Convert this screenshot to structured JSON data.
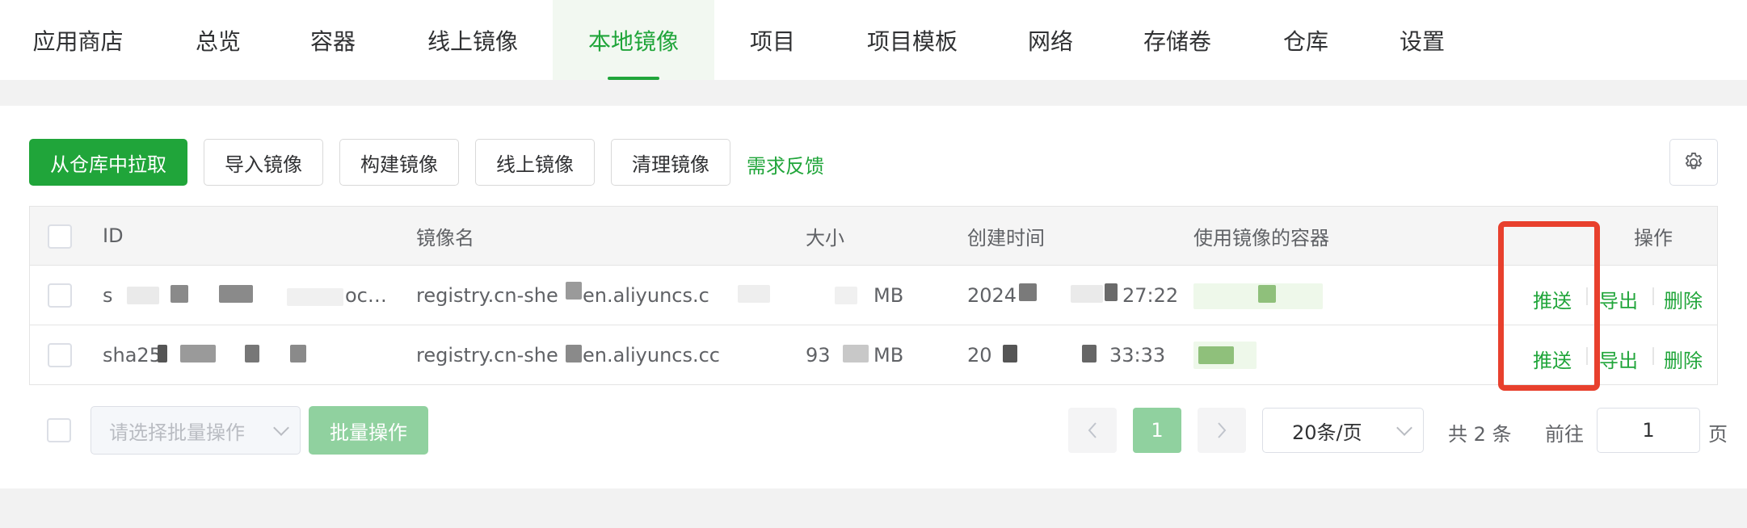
{
  "tabs": [
    {
      "label": "应用商店"
    },
    {
      "label": "总览"
    },
    {
      "label": "容器"
    },
    {
      "label": "线上镜像"
    },
    {
      "label": "本地镜像"
    },
    {
      "label": "项目"
    },
    {
      "label": "项目模板"
    },
    {
      "label": "网络"
    },
    {
      "label": "存储卷"
    },
    {
      "label": "仓库"
    },
    {
      "label": "设置"
    }
  ],
  "active_tab": "本地镜像",
  "toolbar": {
    "pull_label": "从仓库中拉取",
    "import_label": "导入镜像",
    "build_label": "构建镜像",
    "online_label": "线上镜像",
    "clean_label": "清理镜像",
    "feedback_label": "需求反馈",
    "settings_icon": "gear-icon"
  },
  "table": {
    "columns": [
      "ID",
      "镜像名",
      "大小",
      "创建时间",
      "使用镜像的容器",
      "操作"
    ],
    "rows": [
      {
        "id": "s",
        "id_tail": "oc…",
        "name": "registry.cn-she",
        "name_tail": "en.aliyuncs.c",
        "size": "MB",
        "created": "2024",
        "created_tail": "27:22",
        "actions": [
          "推送",
          "导出",
          "删除"
        ]
      },
      {
        "id": "sha25",
        "id_tail": "",
        "name": "registry.cn-she",
        "name_tail": "en.aliyuncs.cc",
        "size_prefix": "93",
        "size": "MB",
        "created": "20",
        "created_tail": "33:33",
        "actions": [
          "推送",
          "导出",
          "删除"
        ]
      }
    ]
  },
  "footer": {
    "batch_placeholder": "请选择批量操作",
    "batch_button": "批量操作",
    "current_page": "1",
    "page_size": "20条/页",
    "total": "共 2 条",
    "goto_label": "前往",
    "goto_value": "1",
    "page_suffix": "页"
  },
  "colors": {
    "accent": "#20a53a",
    "highlight": "#e8402d"
  }
}
